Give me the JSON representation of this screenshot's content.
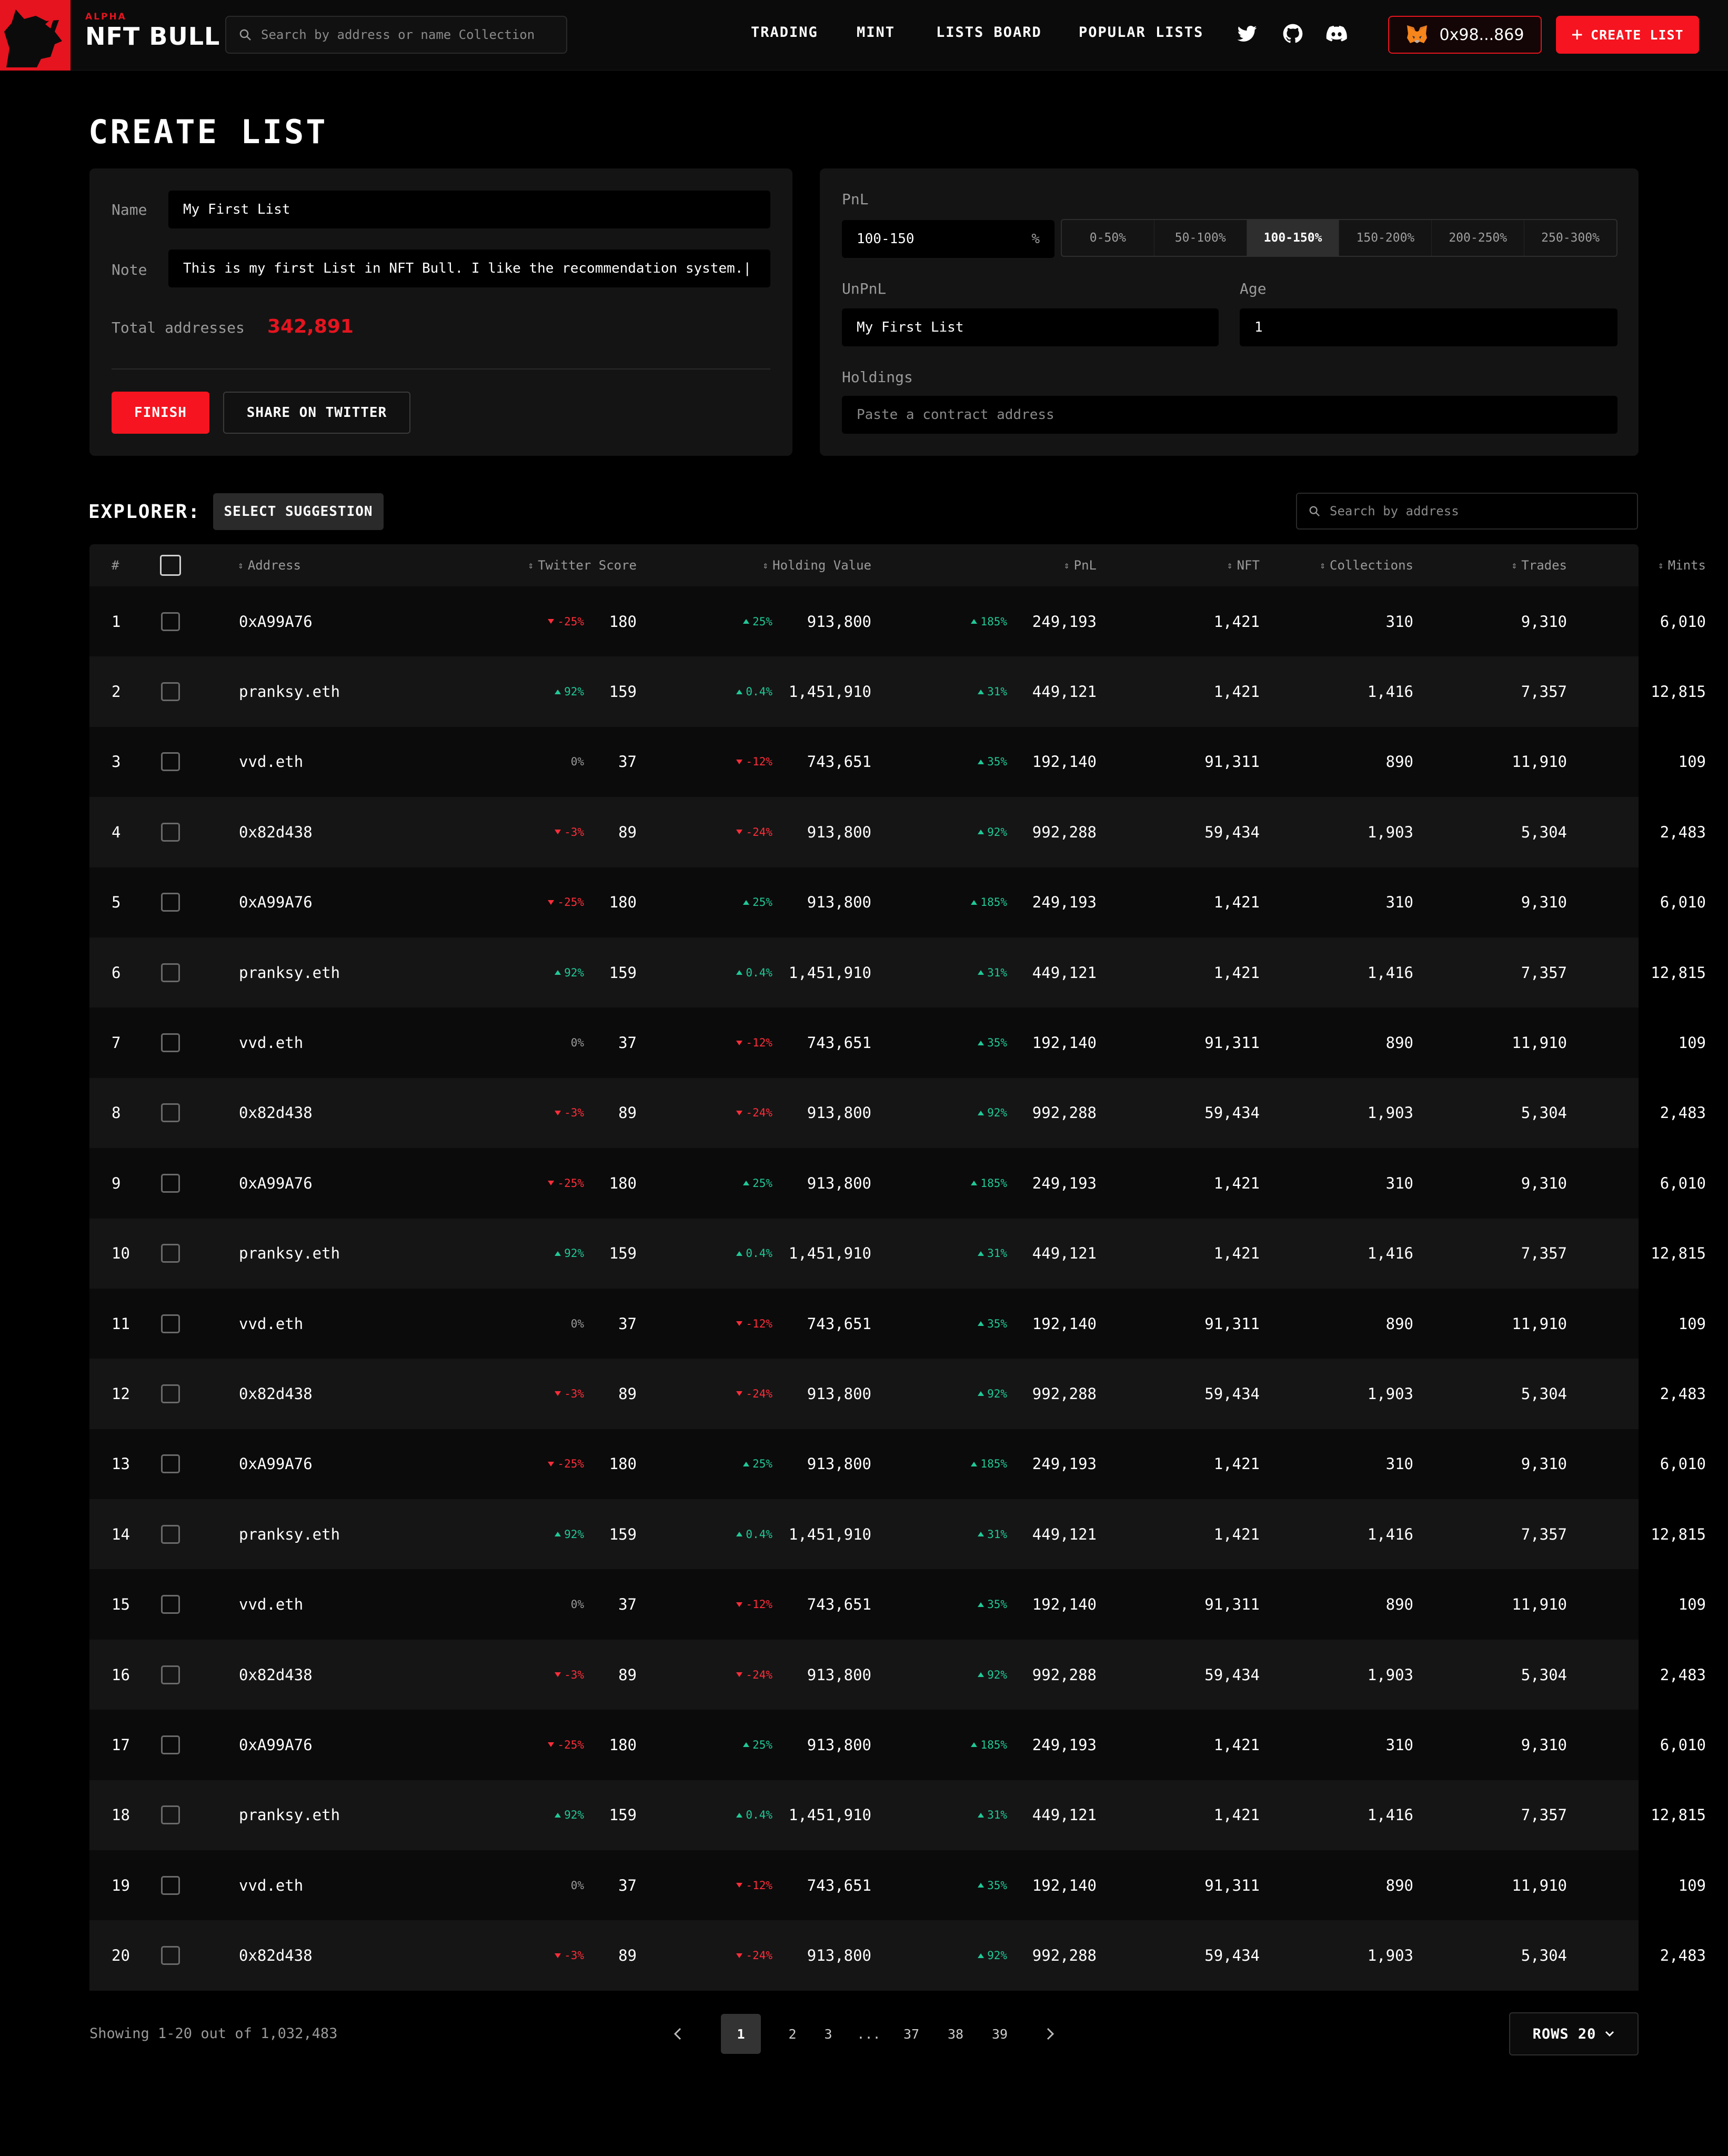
{
  "header": {
    "logo_alpha": "ALPHA",
    "logo_name": "NFT BULL",
    "search_placeholder": "Search by address or name Collection",
    "nav": [
      "TRADING",
      "MINT",
      "LISTS BOARD",
      "POPULAR LISTS"
    ],
    "wallet_address": "0x98...869",
    "create_label": "CREATE LIST",
    "accent": "#f5141f"
  },
  "page_title": "CREATE LIST",
  "form": {
    "name_label": "Name",
    "name_value": "My First List",
    "note_label": "Note",
    "note_value": "This is my first List in NFT Bull. I like the recommendation system.|",
    "total_label": "Total addresses",
    "total_value": "342,891",
    "finish_label": "FINISH",
    "share_label": "SHARE ON TWITTER"
  },
  "filters": {
    "pnl_label": "PnL",
    "pnl_value": "100-150",
    "pnl_unit": "%",
    "ranges": [
      "0-50%",
      "50-100%",
      "100-150%",
      "150-200%",
      "200-250%",
      "250-300%"
    ],
    "active_range": "100-150%",
    "unpnl_label": "UnPnL",
    "unpnl_value": "My First List",
    "age_label": "Age",
    "age_value": "1",
    "holdings_label": "Holdings",
    "holdings_placeholder": "Paste a contract address"
  },
  "explorer": {
    "label": "EXPLORER:",
    "suggest_label": "SELECT SUGGESTION",
    "search_placeholder": "Search by address",
    "columns": [
      "#",
      "Address",
      "Twitter Score",
      "Holding Value",
      "PnL",
      "NFT",
      "Collections",
      "Trades",
      "Mints"
    ],
    "rows": [
      {
        "n": "1",
        "address": "0xA99A76",
        "tw_delta": "-25%",
        "tw_dir": "down",
        "tw": "180",
        "hv_delta": "25%",
        "hv_dir": "up",
        "hv": "913,800",
        "pnl_delta": "185%",
        "pnl_dir": "up",
        "pnl": "249,193",
        "nft": "1,421",
        "collections": "310",
        "trades": "9,310",
        "mints": "6,010"
      },
      {
        "n": "2",
        "address": "pranksy.eth",
        "tw_delta": "92%",
        "tw_dir": "up",
        "tw": "159",
        "hv_delta": "0.4%",
        "hv_dir": "up",
        "hv": "1,451,910",
        "pnl_delta": "31%",
        "pnl_dir": "up",
        "pnl": "449,121",
        "nft": "1,421",
        "collections": "1,416",
        "trades": "7,357",
        "mints": "12,815"
      },
      {
        "n": "3",
        "address": "vvd.eth",
        "tw_delta": "0%",
        "tw_dir": "flat",
        "tw": "37",
        "hv_delta": "-12%",
        "hv_dir": "down",
        "hv": "743,651",
        "pnl_delta": "35%",
        "pnl_dir": "up",
        "pnl": "192,140",
        "nft": "91,311",
        "collections": "890",
        "trades": "11,910",
        "mints": "109"
      },
      {
        "n": "4",
        "address": "0x82d438",
        "tw_delta": "-3%",
        "tw_dir": "down",
        "tw": "89",
        "hv_delta": "-24%",
        "hv_dir": "down",
        "hv": "913,800",
        "pnl_delta": "92%",
        "pnl_dir": "up",
        "pnl": "992,288",
        "nft": "59,434",
        "collections": "1,903",
        "trades": "5,304",
        "mints": "2,483"
      },
      {
        "n": "5",
        "address": "0xA99A76",
        "tw_delta": "-25%",
        "tw_dir": "down",
        "tw": "180",
        "hv_delta": "25%",
        "hv_dir": "up",
        "hv": "913,800",
        "pnl_delta": "185%",
        "pnl_dir": "up",
        "pnl": "249,193",
        "nft": "1,421",
        "collections": "310",
        "trades": "9,310",
        "mints": "6,010"
      },
      {
        "n": "6",
        "address": "pranksy.eth",
        "tw_delta": "92%",
        "tw_dir": "up",
        "tw": "159",
        "hv_delta": "0.4%",
        "hv_dir": "up",
        "hv": "1,451,910",
        "pnl_delta": "31%",
        "pnl_dir": "up",
        "pnl": "449,121",
        "nft": "1,421",
        "collections": "1,416",
        "trades": "7,357",
        "mints": "12,815"
      },
      {
        "n": "7",
        "address": "vvd.eth",
        "tw_delta": "0%",
        "tw_dir": "flat",
        "tw": "37",
        "hv_delta": "-12%",
        "hv_dir": "down",
        "hv": "743,651",
        "pnl_delta": "35%",
        "pnl_dir": "up",
        "pnl": "192,140",
        "nft": "91,311",
        "collections": "890",
        "trades": "11,910",
        "mints": "109"
      },
      {
        "n": "8",
        "address": "0x82d438",
        "tw_delta": "-3%",
        "tw_dir": "down",
        "tw": "89",
        "hv_delta": "-24%",
        "hv_dir": "down",
        "hv": "913,800",
        "pnl_delta": "92%",
        "pnl_dir": "up",
        "pnl": "992,288",
        "nft": "59,434",
        "collections": "1,903",
        "trades": "5,304",
        "mints": "2,483"
      },
      {
        "n": "9",
        "address": "0xA99A76",
        "tw_delta": "-25%",
        "tw_dir": "down",
        "tw": "180",
        "hv_delta": "25%",
        "hv_dir": "up",
        "hv": "913,800",
        "pnl_delta": "185%",
        "pnl_dir": "up",
        "pnl": "249,193",
        "nft": "1,421",
        "collections": "310",
        "trades": "9,310",
        "mints": "6,010"
      },
      {
        "n": "10",
        "address": "pranksy.eth",
        "tw_delta": "92%",
        "tw_dir": "up",
        "tw": "159",
        "hv_delta": "0.4%",
        "hv_dir": "up",
        "hv": "1,451,910",
        "pnl_delta": "31%",
        "pnl_dir": "up",
        "pnl": "449,121",
        "nft": "1,421",
        "collections": "1,416",
        "trades": "7,357",
        "mints": "12,815"
      },
      {
        "n": "11",
        "address": "vvd.eth",
        "tw_delta": "0%",
        "tw_dir": "flat",
        "tw": "37",
        "hv_delta": "-12%",
        "hv_dir": "down",
        "hv": "743,651",
        "pnl_delta": "35%",
        "pnl_dir": "up",
        "pnl": "192,140",
        "nft": "91,311",
        "collections": "890",
        "trades": "11,910",
        "mints": "109"
      },
      {
        "n": "12",
        "address": "0x82d438",
        "tw_delta": "-3%",
        "tw_dir": "down",
        "tw": "89",
        "hv_delta": "-24%",
        "hv_dir": "down",
        "hv": "913,800",
        "pnl_delta": "92%",
        "pnl_dir": "up",
        "pnl": "992,288",
        "nft": "59,434",
        "collections": "1,903",
        "trades": "5,304",
        "mints": "2,483"
      },
      {
        "n": "13",
        "address": "0xA99A76",
        "tw_delta": "-25%",
        "tw_dir": "down",
        "tw": "180",
        "hv_delta": "25%",
        "hv_dir": "up",
        "hv": "913,800",
        "pnl_delta": "185%",
        "pnl_dir": "up",
        "pnl": "249,193",
        "nft": "1,421",
        "collections": "310",
        "trades": "9,310",
        "mints": "6,010"
      },
      {
        "n": "14",
        "address": "pranksy.eth",
        "tw_delta": "92%",
        "tw_dir": "up",
        "tw": "159",
        "hv_delta": "0.4%",
        "hv_dir": "up",
        "hv": "1,451,910",
        "pnl_delta": "31%",
        "pnl_dir": "up",
        "pnl": "449,121",
        "nft": "1,421",
        "collections": "1,416",
        "trades": "7,357",
        "mints": "12,815"
      },
      {
        "n": "15",
        "address": "vvd.eth",
        "tw_delta": "0%",
        "tw_dir": "flat",
        "tw": "37",
        "hv_delta": "-12%",
        "hv_dir": "down",
        "hv": "743,651",
        "pnl_delta": "35%",
        "pnl_dir": "up",
        "pnl": "192,140",
        "nft": "91,311",
        "collections": "890",
        "trades": "11,910",
        "mints": "109"
      },
      {
        "n": "16",
        "address": "0x82d438",
        "tw_delta": "-3%",
        "tw_dir": "down",
        "tw": "89",
        "hv_delta": "-24%",
        "hv_dir": "down",
        "hv": "913,800",
        "pnl_delta": "92%",
        "pnl_dir": "up",
        "pnl": "992,288",
        "nft": "59,434",
        "collections": "1,903",
        "trades": "5,304",
        "mints": "2,483"
      },
      {
        "n": "17",
        "address": "0xA99A76",
        "tw_delta": "-25%",
        "tw_dir": "down",
        "tw": "180",
        "hv_delta": "25%",
        "hv_dir": "up",
        "hv": "913,800",
        "pnl_delta": "185%",
        "pnl_dir": "up",
        "pnl": "249,193",
        "nft": "1,421",
        "collections": "310",
        "trades": "9,310",
        "mints": "6,010"
      },
      {
        "n": "18",
        "address": "pranksy.eth",
        "tw_delta": "92%",
        "tw_dir": "up",
        "tw": "159",
        "hv_delta": "0.4%",
        "hv_dir": "up",
        "hv": "1,451,910",
        "pnl_delta": "31%",
        "pnl_dir": "up",
        "pnl": "449,121",
        "nft": "1,421",
        "collections": "1,416",
        "trades": "7,357",
        "mints": "12,815"
      },
      {
        "n": "19",
        "address": "vvd.eth",
        "tw_delta": "0%",
        "tw_dir": "flat",
        "tw": "37",
        "hv_delta": "-12%",
        "hv_dir": "down",
        "hv": "743,651",
        "pnl_delta": "35%",
        "pnl_dir": "up",
        "pnl": "192,140",
        "nft": "91,311",
        "collections": "890",
        "trades": "11,910",
        "mints": "109"
      },
      {
        "n": "20",
        "address": "0x82d438",
        "tw_delta": "-3%",
        "tw_dir": "down",
        "tw": "89",
        "hv_delta": "-24%",
        "hv_dir": "down",
        "hv": "913,800",
        "pnl_delta": "92%",
        "pnl_dir": "up",
        "pnl": "992,288",
        "nft": "59,434",
        "collections": "1,903",
        "trades": "5,304",
        "mints": "2,483"
      }
    ]
  },
  "footer": {
    "showing": "Showing 1-20 out of 1,032,483",
    "pages": [
      "1",
      "2",
      "3",
      "...",
      "37",
      "38",
      "39"
    ],
    "active_page": "1",
    "rows_label": "ROWS 20"
  }
}
